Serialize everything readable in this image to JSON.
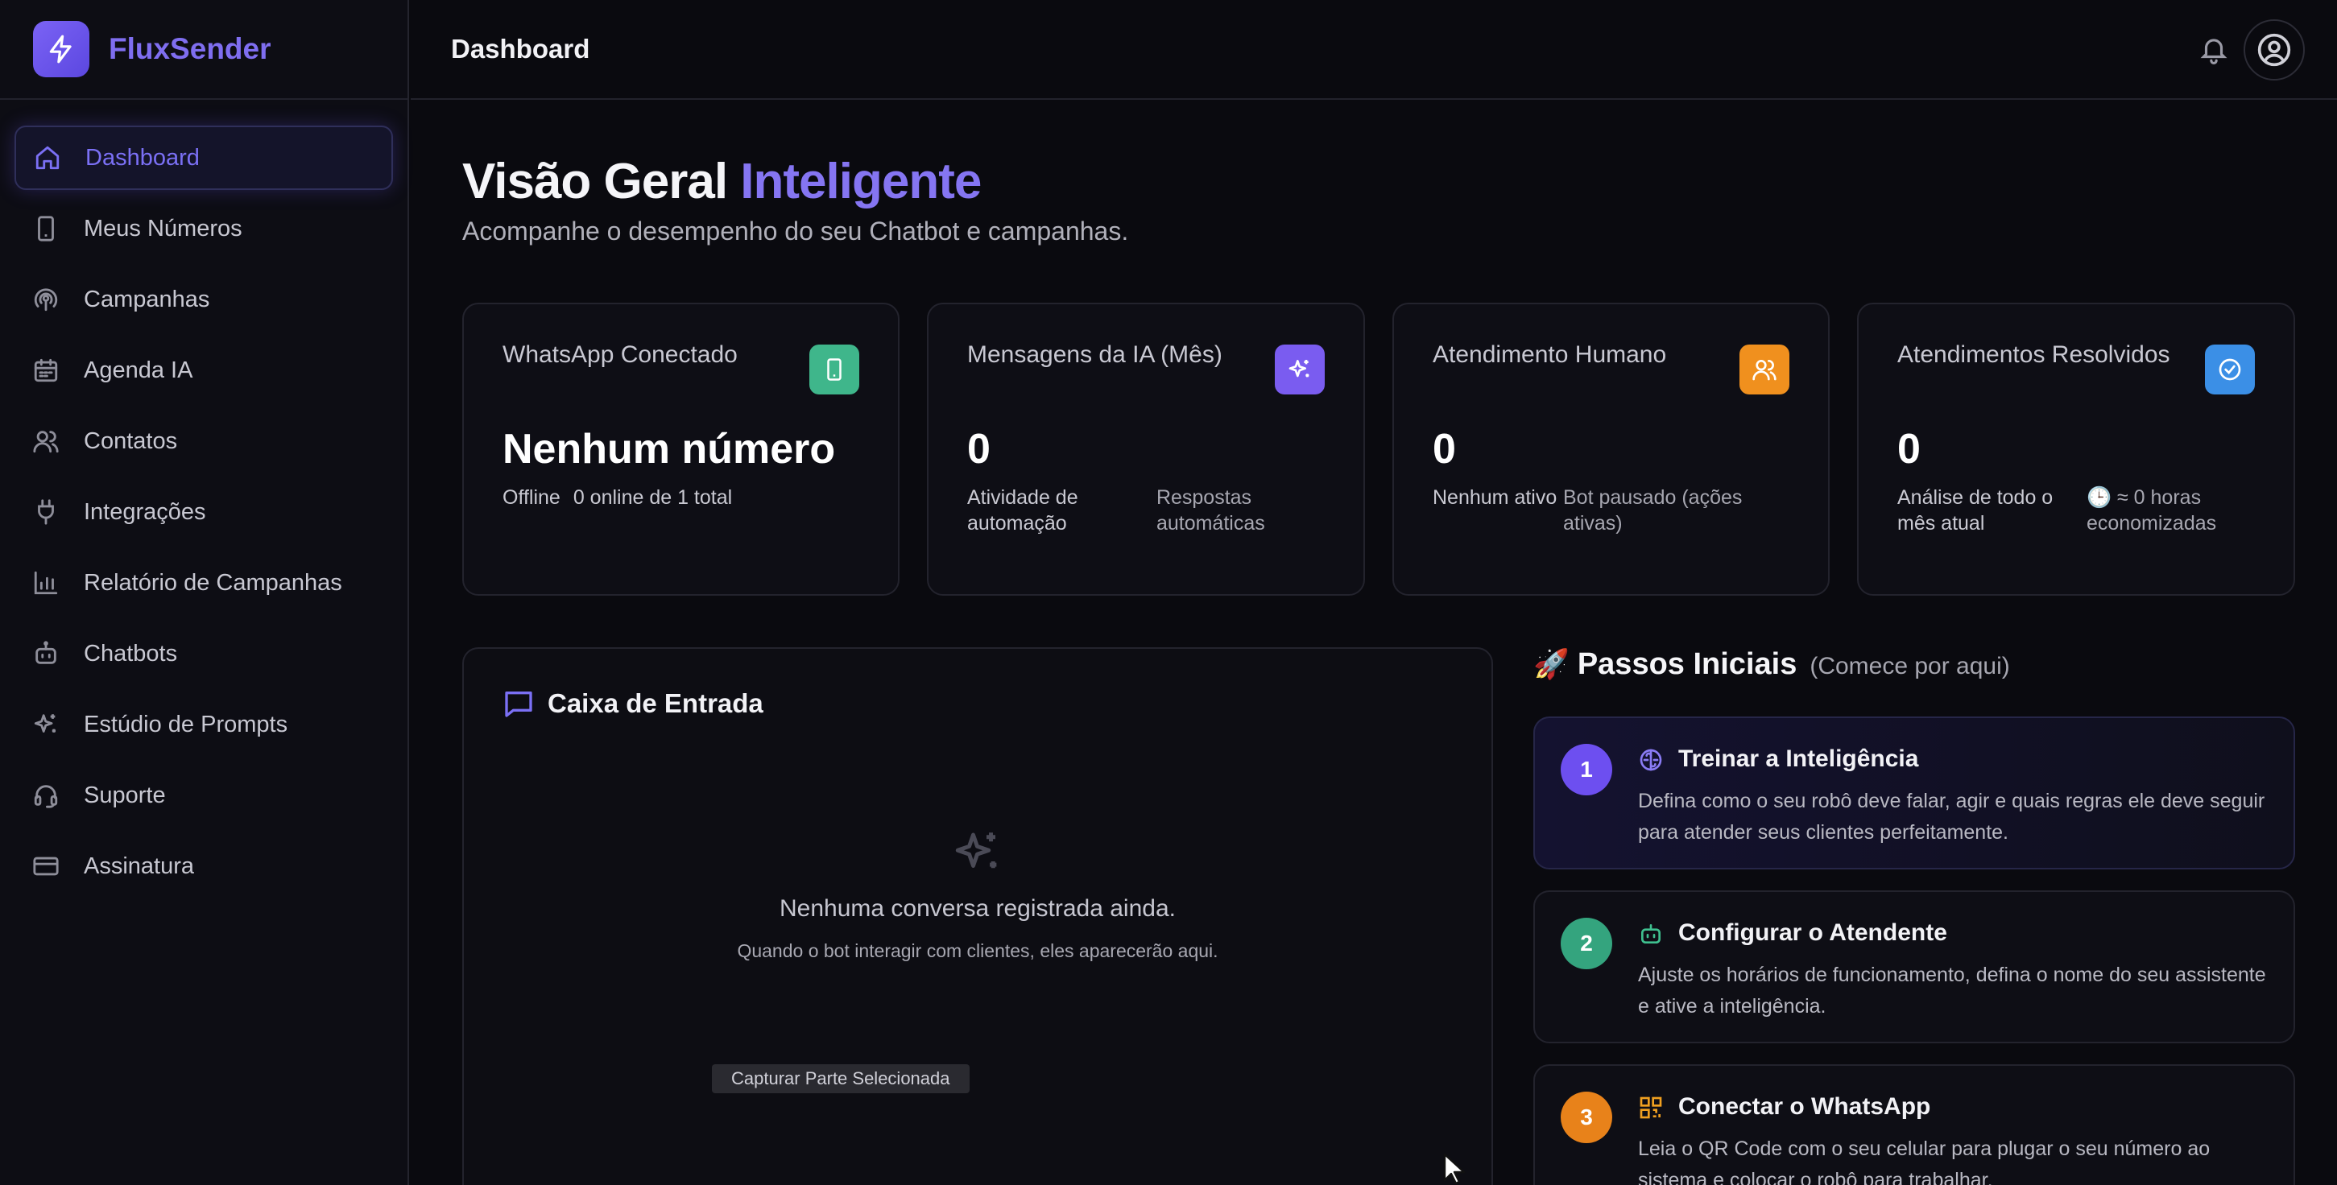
{
  "app": {
    "name": "FluxSender"
  },
  "sidebar": {
    "items": [
      {
        "label": "Dashboard",
        "icon": "home-icon",
        "active": true
      },
      {
        "label": "Meus Números",
        "icon": "smartphone-icon"
      },
      {
        "label": "Campanhas",
        "icon": "broadcast-icon"
      },
      {
        "label": "Agenda IA",
        "icon": "calendar-icon"
      },
      {
        "label": "Contatos",
        "icon": "users-icon"
      },
      {
        "label": "Integrações",
        "icon": "plug-icon"
      },
      {
        "label": "Relatório de Campanhas",
        "icon": "bar-chart-icon"
      },
      {
        "label": "Chatbots",
        "icon": "bot-icon"
      },
      {
        "label": "Estúdio de Prompts",
        "icon": "sparkles-icon"
      },
      {
        "label": "Suporte",
        "icon": "headset-icon"
      },
      {
        "label": "Assinatura",
        "icon": "credit-card-icon"
      }
    ]
  },
  "header": {
    "title": "Dashboard"
  },
  "main": {
    "title_plain": "Visão Geral",
    "title_accent": "Inteligente",
    "subtitle": "Acompanhe o desempenho do seu Chatbot e campanhas."
  },
  "cards": [
    {
      "title": "WhatsApp Conectado",
      "value": "Nenhum número",
      "foot_a": "Offline",
      "foot_b": "0 online de 1 total",
      "icon": "smartphone-icon",
      "color": "#3fb68b"
    },
    {
      "title": "Mensagens da IA (Mês)",
      "value": "0",
      "foot_a": "Atividade de automação",
      "foot_b": "Respostas automáticas",
      "icon": "sparkles-icon",
      "color": "#7a5cf0"
    },
    {
      "title": "Atendimento Humano",
      "value": "0",
      "foot_a": "Nenhum ativo",
      "foot_b": "Bot pausado (ações ativas)",
      "icon": "users-icon",
      "color": "#f0901e"
    },
    {
      "title": "Atendimentos Resolvidos",
      "value": "0",
      "foot_a": "Análise de todo o mês atual",
      "foot_b": "🕒 ≈ 0 horas economizadas",
      "icon": "check-circle-icon",
      "color": "#3b8fe6"
    }
  ],
  "inbox": {
    "title": "Caixa de Entrada",
    "empty_title": "Nenhuma conversa registrada ainda.",
    "empty_sub": "Quando o bot interagir com clientes, eles aparecerão aqui.",
    "capture_label": "Capturar Parte Selecionada"
  },
  "steps": {
    "emoji": "🚀",
    "title": "Passos Iniciais",
    "hint": "(Comece por aqui)",
    "items": [
      {
        "num": "1",
        "title": "Treinar a Inteligência",
        "desc": "Defina como o seu robô deve falar, agir e quais regras ele deve seguir para atender seus clientes perfeitamente.",
        "icon": "brain-icon",
        "color": "#6d4ff0",
        "icon_color": "#8a7cf5"
      },
      {
        "num": "2",
        "title": "Configurar o Atendente",
        "desc": "Ajuste os horários de funcionamento, defina o nome do seu assistente e ative a inteligência.",
        "icon": "bot-icon",
        "color": "#34a47e",
        "icon_color": "#3fc08f"
      },
      {
        "num": "3",
        "title": "Conectar o WhatsApp",
        "desc": "Leia o QR Code com o seu celular para plugar o seu número ao sistema e colocar o robô para trabalhar.",
        "icon": "qr-code-icon",
        "color": "#e8821a",
        "icon_color": "#f0a020"
      }
    ]
  }
}
